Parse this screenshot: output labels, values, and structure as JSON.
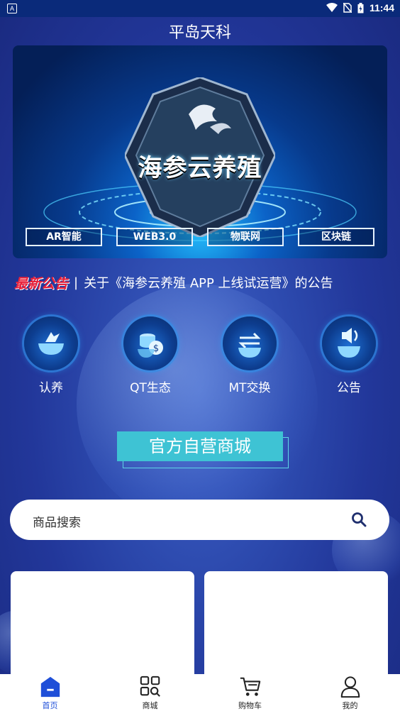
{
  "status_bar": {
    "time": "11:44",
    "notif_icon": "A"
  },
  "app_title": "平岛天科",
  "banner": {
    "main_text": "海参云养殖",
    "tags": [
      "AR智能",
      "WEB3.0",
      "物联网",
      "区块链"
    ]
  },
  "notice": {
    "label": "最新公告",
    "separator": "|",
    "text": "关于《海参云养殖 APP 上线试运营》的公告"
  },
  "quick_actions": [
    {
      "label": "认养",
      "icon": "adopt-icon"
    },
    {
      "label": "QT生态",
      "icon": "coin-icon"
    },
    {
      "label": "MT交换",
      "icon": "exchange-icon"
    },
    {
      "label": "公告",
      "icon": "speaker-icon"
    }
  ],
  "mall_title": "官方自营商城",
  "search": {
    "placeholder": "商品搜索"
  },
  "tabbar": {
    "items": [
      {
        "label": "首页",
        "icon": "home-icon",
        "active": true
      },
      {
        "label": "商城",
        "icon": "mall-icon",
        "active": false
      },
      {
        "label": "购物车",
        "icon": "cart-icon",
        "active": false
      },
      {
        "label": "我的",
        "icon": "user-icon",
        "active": false
      }
    ]
  },
  "colors": {
    "accent": "#1f4fd8",
    "notice_label": "#e8203a",
    "mall_title_bg": "#3ec3d4"
  }
}
